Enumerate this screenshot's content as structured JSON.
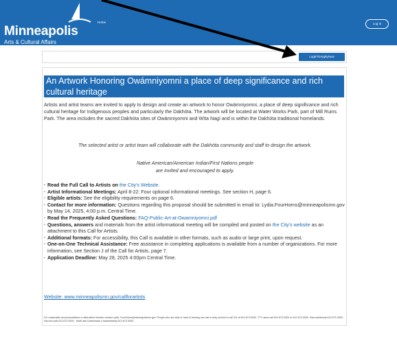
{
  "header": {
    "city": "Minneapolis",
    "subtitle": "Arts & Cultural Affairs",
    "nav_home": "Home",
    "login": "Log In"
  },
  "apply_button": "LogInToApplyNow",
  "title": "An Artwork Honoring Owámniyomni a place of deep significance and rich cultural heritage",
  "intro": "Artists and artist teams are invited to apply to design and create an artwork to honor Owámniyomni, a place of deep significance and rich cultural heritage for Indigenous peoples and particularly the Dakhóta. The artwork will be located at Water Works Park, part of Mill Ruins Park. The area includes the sacred Dakhóta sites of Owámniyomni and Wíta Nagí and is within the Dakhóta traditional homelands.",
  "collab": "The selected artist or artist team will collaborate with the Dakhóta community and staff to design the artwork.",
  "encouraged_line1": "Native American/American Indian/First Nations people",
  "encouraged_line2": "are invited and encouraged to apply.",
  "bullets": [
    {
      "bold": "Read the Full Call to Artists on",
      "text": " ",
      "link": "the City's Website.",
      "after": ""
    },
    {
      "bold": "Artist Informational Meetings:",
      "text": " April 8-22: Four optional informational meetings. See section H, page 6.",
      "link": "",
      "after": ""
    },
    {
      "bold": "Eligible artists:",
      "text": " See the eligibility requirements on page 6.",
      "link": "",
      "after": ""
    },
    {
      "bold": "Contact for more information:",
      "text": " Questions regarding this proposal should be submitted in email to: Lydia.FourHorns@minneapolismn.gov by May 14, 2025, 4:00 p.m. Central Time.",
      "link": "",
      "after": ""
    },
    {
      "bold": "Read the Frequently Asked Questions:",
      "text": " ",
      "link": "FAQ-Public-Art-at-Owamniyomni.pdf",
      "after": ""
    },
    {
      "bold": "Questions, answers",
      "text": " and materials from the artist informational meeting will be compiled and posted on ",
      "link": "the City's website",
      "after": " as an attachment to this Call for Artists."
    },
    {
      "bold": "Additional formats:",
      "text": " For accessibility, this Call is available in other formats, such as audio or large print, upon request.",
      "link": "",
      "after": ""
    },
    {
      "bold": "One-on-One Technical Assistance:",
      "text": " Free assistance in completing applications is available from a number of organizations. For more information, see Section J of the Call for Artists, page 7.",
      "link": "",
      "after": ""
    },
    {
      "bold": "Application Deadline:",
      "text": " May 28, 2025 4:00pm Central Time.",
      "link": "",
      "after": ""
    }
  ],
  "website_label": "Website: www.minneapolismn.gov/callforartists",
  "footer": "For reasonable accommodations or alternative formats contact Lydia. FourHorns@minneapolismn.gov. People who are deaf or hard of hearing can use a relay service to call 311 at 612-673-3000. TTY users call 612-673-3000 or 612-673-3000. Para asistencia 612-673-3000 - Rau kev pab 612-673-3000 - Hadii aad Caawimaad u baahantahay 612-673-3000.",
  "colors": {
    "brand": "#1f6bb3"
  }
}
